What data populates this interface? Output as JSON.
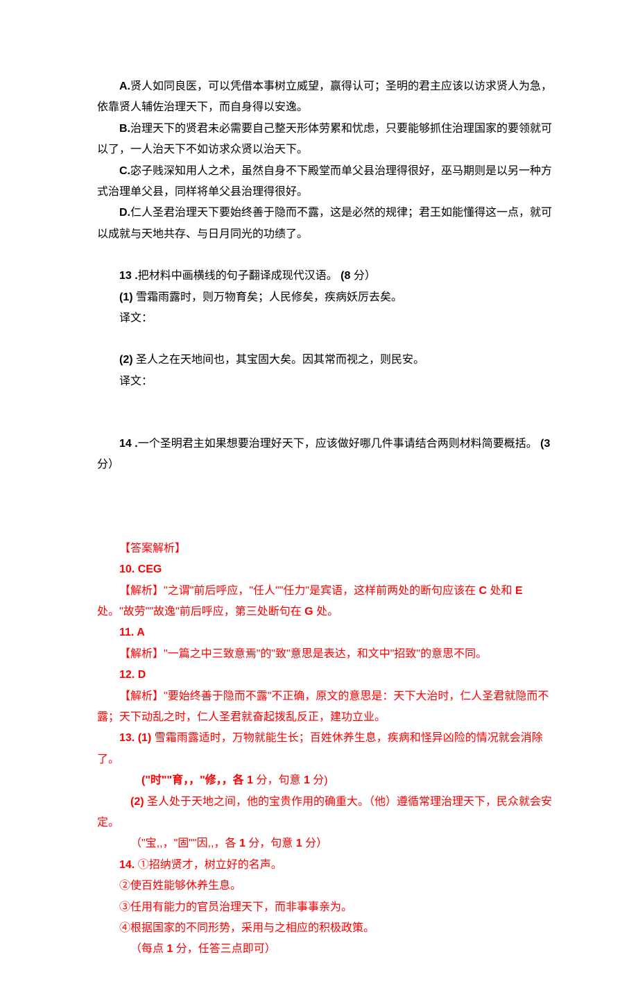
{
  "options": {
    "A_label": "A.",
    "A_text": "贤人如同良医，可以凭借本事树立威望，赢得认可；圣明的君主应该以访求贤人为急，依靠贤人辅佐治理天下，而自身得以安逸。",
    "B_label": "B.",
    "B_text": "治理天下的贤君未必需要自己整天形体劳累和忧虑，只要能够抓住治理国家的要领就可以了，一人治天下不如访求众贤以治天下。",
    "C_label": "C.",
    "C_text": "宓子贱深知用人之术，虽然自身不下殿堂而单父县治理得很好，巫马期则是以另一种方式治理单父县，同样将单父县治理得很好。",
    "D_label": "D.",
    "D_text": "仁人圣君治理天下要始终善于隐而不露，这是必然的规律；君王如能懂得这一点，就可以成就与天地共存、与日月同光的功绩了。"
  },
  "q13": {
    "num": "13",
    "dot": " .",
    "stem": "把材料中画横线的句子翻译成现代汉语。 ",
    "score": "(8",
    "score_unit": " 分）",
    "s1_label": " (1)",
    "s1_text": " 雪霜雨露时，则万物育矣；人民修矣，疾病妖厉去矣。",
    "s2_label": " (2)",
    "s2_text": " 圣人之在天地间也，其宝固大矣。因其常而视之，则民安。",
    "yiwen": "译文：",
    "yiwen2": "译文："
  },
  "q14": {
    "num": "14",
    "dot": " .",
    "stem": "一个圣明君主如果想要治理好天下，应该做好哪几件事请结合两则材料简要概括。 ",
    "score": "(3",
    "score_unit": " 分）"
  },
  "answers": {
    "header": "【答案解析】",
    "a10_label": "10.   CEG",
    "a10_prefix": "【解析】",
    "a10_text": "\"之谓\"前后呼应，\"任人\"\"任力\"是宾语，这样前两处的断句应该在 ",
    "a10_c": "C",
    "a10_mid": " 处和 ",
    "a10_e": "E",
    "a10_text2": " 处。\"故劳\"\"故逸\"前后呼应，第三处断句在 ",
    "a10_g": "G",
    "a10_text3": " 处。",
    "a11_label": "11.   A",
    "a11_prefix": "【解析】",
    "a11_text": "\"一篇之中三致意焉\"的\"致\"意思是表达，和文中\"招致\"的意思不同。",
    "a12_label": "12.   D",
    "a12_prefix": "【解析】",
    "a12_text": "\"要始终善于隐而不露\"不正确，原文的意思是：天下大治时，仁人圣君就隐而不露；天下动乱之时，仁人圣君就奋起拨乱反正，建功立业。",
    "a13_label": "13.    (1)",
    "a13_1": " 雪霜雨露适时，万物就能生长；百姓休养生息，疾病和怪异凶险的情况就会消除了。",
    "a13_1_note": "(\"时\"\"育，，\"修，，各 ",
    "a13_1_one_a": "1",
    "a13_1_mid": " 分，句意 ",
    "a13_1_one_b": "1",
    "a13_1_end": " 分)",
    "a13_2_label": "(2)",
    "a13_2": " 圣人处于天地之间，他的宝贵作用的确重大。（他）遵循常理治理天下，民众就会安定。",
    "a13_2_note": "（\"宝,,，\"固\"\"因,,，各 ",
    "a13_2_one_a": "1",
    "a13_2_mid": " 分，句意 ",
    "a13_2_one_b": "1",
    "a13_2_end": " 分）",
    "a14_label": "14.",
    "a14_1": " ①招纳贤才，树立好的名声。",
    "a14_2": "②使百姓能够休养生息。",
    "a14_3": "③任用有能力的官员治理天下，而非事事亲为。",
    "a14_4": "④根据国家的不同形势，采用与之相应的积极政策。",
    "a14_note_pre": "（每点 ",
    "a14_one": "1",
    "a14_note_post": " 分，任答三点即可）"
  }
}
